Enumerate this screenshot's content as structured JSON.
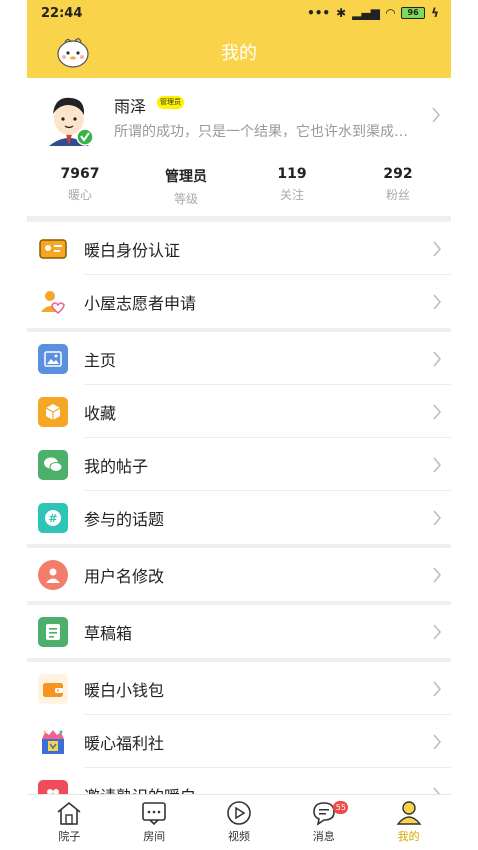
{
  "status_bar": {
    "time": "22:44",
    "battery": "96"
  },
  "header": {
    "title": "我的"
  },
  "profile": {
    "name": "雨泽",
    "badge": "管理员",
    "motto": "所谓的成功，只是一个结果，它也许水到渠成…"
  },
  "stats": [
    {
      "value": "7967",
      "label": "暖心"
    },
    {
      "value": "管理员",
      "label": "等级"
    },
    {
      "value": "119",
      "label": "关注"
    },
    {
      "value": "292",
      "label": "粉丝"
    }
  ],
  "menu": {
    "identity": "暖白身份认证",
    "volunteer": "小屋志愿者申请",
    "homepage": "主页",
    "favorites": "收藏",
    "my_posts": "我的帖子",
    "topics": "参与的话题",
    "rename": "用户名修改",
    "drafts": "草稿箱",
    "wallet": "暖白小钱包",
    "welfare": "暖心福利社",
    "invite": "邀请熟识的暖白"
  },
  "tabbar": {
    "tabs": [
      {
        "label": "院子"
      },
      {
        "label": "房间"
      },
      {
        "label": "视频"
      },
      {
        "label": "消息",
        "badge": "55"
      },
      {
        "label": "我的"
      }
    ]
  },
  "colors": {
    "brand": "#f9d34a",
    "active_tab": "#d6a700",
    "badge": "#f04747"
  }
}
